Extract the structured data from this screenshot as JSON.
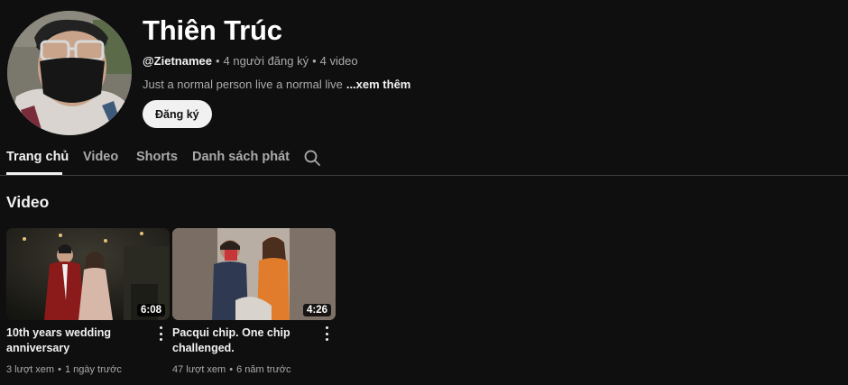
{
  "channel": {
    "name": "Thiên Trúc",
    "handle": "@Zietnamee",
    "subscribers": "4 người đăng ký",
    "video_count": "4 video",
    "description": "Just a normal person live a normal live",
    "more_label": "...xem thêm",
    "subscribe_label": "Đăng ký"
  },
  "tabs": [
    {
      "label": "Trang chủ",
      "active": true
    },
    {
      "label": "Video",
      "active": false
    },
    {
      "label": "Shorts",
      "active": false
    },
    {
      "label": "Danh sách phát",
      "active": false
    }
  ],
  "section": {
    "title": "Video"
  },
  "videos": [
    {
      "title": "10th years wedding anniversary",
      "duration": "6:08",
      "views": "3 lượt xem",
      "age": "1 ngày trước"
    },
    {
      "title": "Pacqui chip. One chip challenged.",
      "duration": "4:26",
      "views": "47 lượt xem",
      "age": "6 năm trước"
    }
  ],
  "icons": {
    "search": "search-icon",
    "more": "more-vert-icon"
  }
}
